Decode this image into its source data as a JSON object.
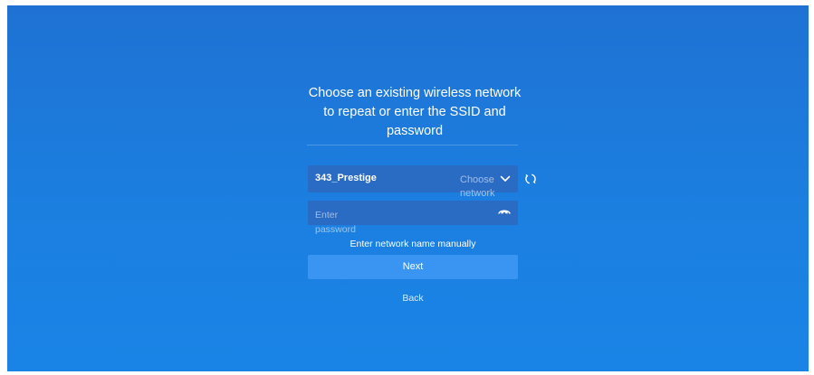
{
  "wizard": {
    "heading": "Choose an existing wireless network to repeat or enter the SSID and password",
    "ssid_select": {
      "value": "343_Prestige",
      "placeholder": "Choose network",
      "dropdown_icon": "chevron-down-icon"
    },
    "refresh_icon": "refresh-icon",
    "password": {
      "value": "",
      "placeholder": "Enter password",
      "visibility_icon": "eye-icon"
    },
    "manual_entry_label": "Enter network name manually",
    "next_label": "Next",
    "back_label": "Back"
  },
  "colors": {
    "background_top": "#1f72d3",
    "background_bottom": "#1a84e6",
    "field_background": "#2a6bc4",
    "primary_button": "#3a95f2",
    "text": "#ffffff"
  }
}
